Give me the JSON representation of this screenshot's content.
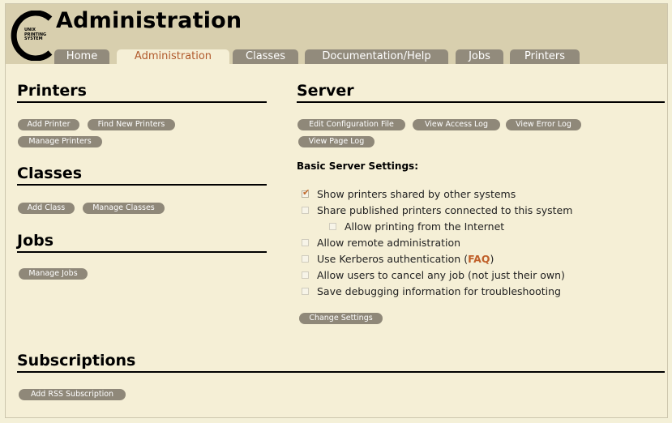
{
  "app": {
    "title": "Administration",
    "logo_lines": [
      "UNIX",
      "PRINTING",
      "SYSTEM"
    ]
  },
  "tabs": [
    {
      "label": "Home",
      "active": false
    },
    {
      "label": "Administration",
      "active": true
    },
    {
      "label": "Classes",
      "active": false
    },
    {
      "label": "Documentation/Help",
      "active": false
    },
    {
      "label": "Jobs",
      "active": false
    },
    {
      "label": "Printers",
      "active": false
    }
  ],
  "printers": {
    "title": "Printers",
    "buttons": [
      "Add Printer",
      "Find New Printers",
      "Manage Printers"
    ]
  },
  "classes": {
    "title": "Classes",
    "buttons": [
      "Add Class",
      "Manage Classes"
    ]
  },
  "jobs": {
    "title": "Jobs",
    "buttons": [
      "Manage Jobs"
    ]
  },
  "server": {
    "title": "Server",
    "buttons": [
      "Edit Configuration File",
      "View Access Log",
      "View Error Log",
      "View Page Log"
    ],
    "settings_heading": "Basic Server Settings:",
    "settings": [
      {
        "label": "Show printers shared by other systems",
        "checked": true
      },
      {
        "label": "Share published printers connected to this system",
        "checked": false
      },
      {
        "label": "Allow printing from the Internet",
        "checked": false
      },
      {
        "label": "Allow remote administration",
        "checked": false
      },
      {
        "label_prefix": "Use Kerberos authentication (",
        "link": "FAQ",
        "label_suffix": ")",
        "checked": false
      },
      {
        "label": "Allow users to cancel any job (not just their own)",
        "checked": false
      },
      {
        "label": "Save debugging information for troubleshooting",
        "checked": false
      }
    ],
    "change_button": "Change Settings"
  },
  "subscriptions": {
    "title": "Subscriptions",
    "buttons": [
      "Add RSS Subscription"
    ]
  },
  "colors": {
    "accent": "#b15a2c",
    "tab_bg": "#928b7c",
    "header_bg": "#d8cfae",
    "page_bg": "#f5efd6",
    "button_bg": "#8f8879"
  }
}
